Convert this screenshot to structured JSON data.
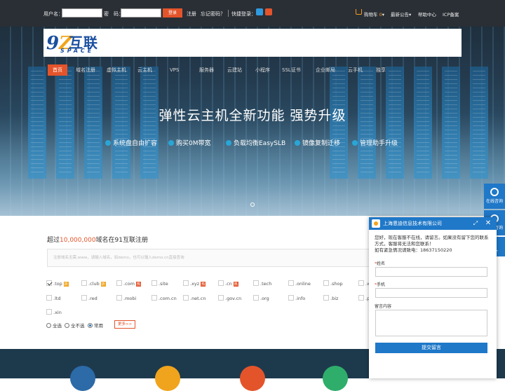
{
  "topbar": {
    "username_label": "用户名：",
    "password_label": "密　码：",
    "login_label": "登录",
    "register_label": "注册",
    "forgot_label": "忘记密码？",
    "quick_login_label": "快捷登录：",
    "cart_label": "购物车",
    "cart_count": "0",
    "notice_label": "最新公告",
    "help_label": "帮助中心",
    "icp_label": "ICP备案"
  },
  "logo": {
    "cn": "互联",
    "en": "SPACE"
  },
  "nav": {
    "items": [
      "首页",
      "域名注册",
      "虚拟主机",
      "云主机",
      "VPS",
      "服务器",
      "云建站",
      "小程序",
      "SSL证书",
      "企业邮局",
      "云手机",
      "独享"
    ]
  },
  "hero": {
    "title": "弹性云主机全新功能  强势升级",
    "features": [
      "系统盘自由扩容",
      "购买0M带宽",
      "负载均衡EasySLB",
      "镜像复制迁移",
      "管理助手升级"
    ]
  },
  "domain": {
    "title_prefix": "超过",
    "title_number": "10,000,000",
    "title_suffix": "域名在91互联注册",
    "search_placeholder": "注册域名无需.www，请输入域名，如demo，也可以输入demo.cn直接查询",
    "tlds": [
      {
        "name": ".top",
        "checked": true,
        "tag": "折"
      },
      {
        "name": ".club",
        "checked": false,
        "tag": "折"
      },
      {
        "name": ".com",
        "checked": false,
        "tag": "热"
      },
      {
        "name": ".site",
        "checked": false,
        "tag": ""
      },
      {
        "name": ".xyz",
        "checked": false,
        "tag": "热"
      },
      {
        "name": ".cn",
        "checked": false,
        "tag": "热"
      },
      {
        "name": ".tech",
        "checked": false,
        "tag": ""
      },
      {
        "name": ".online",
        "checked": false,
        "tag": ""
      },
      {
        "name": ".shop",
        "checked": false,
        "tag": ""
      },
      {
        "name": ".w",
        "checked": false,
        "tag": ""
      },
      {
        "name": ".ltd",
        "checked": false,
        "tag": ""
      },
      {
        "name": ".red",
        "checked": false,
        "tag": ""
      },
      {
        "name": ".mobi",
        "checked": false,
        "tag": ""
      },
      {
        "name": ".com.cn",
        "checked": false,
        "tag": ""
      },
      {
        "name": ".net.cn",
        "checked": false,
        "tag": ""
      },
      {
        "name": ".gov.cn",
        "checked": false,
        "tag": ""
      },
      {
        "name": ".org",
        "checked": false,
        "tag": ""
      },
      {
        "name": ".info",
        "checked": false,
        "tag": ""
      },
      {
        "name": ".biz",
        "checked": false,
        "tag": ""
      },
      {
        "name": ".p",
        "checked": false,
        "tag": ""
      },
      {
        "name": ".xin",
        "checked": false,
        "tag": ""
      }
    ],
    "select_all": "全选",
    "select_none": "全不选",
    "select_common": "常用",
    "more_label": "更多>>"
  },
  "side": {
    "online_label": "在线咨询",
    "phone_label": "电话咨询"
  },
  "chat": {
    "company": "上海恩迪信息技术有限公司",
    "message": "您好，现在客服不在线，请留言。如果没有留下您的联系方式，客服将无法和您联系！\n如有紧急情况请致电：18637150220",
    "name_label": "姓名",
    "phone_label": "手机",
    "content_label": "留言内容",
    "submit_label": "提交留言"
  },
  "colors": {
    "accent": "#e4542b",
    "brand_blue": "#1f78c8",
    "topbar": "#2a2f35"
  }
}
